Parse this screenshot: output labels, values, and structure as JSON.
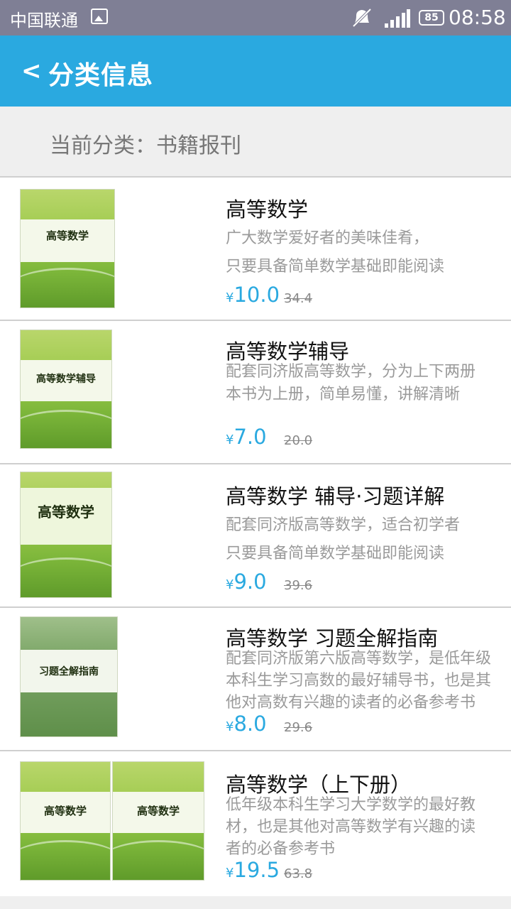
{
  "status_bar": {
    "carrier": "中国联通",
    "battery": "85",
    "time": "08:58"
  },
  "header": {
    "back_symbol": "<",
    "title": "分类信息"
  },
  "category": {
    "text": "当前分类：书籍报刊"
  },
  "items": [
    {
      "title": "高等数学",
      "desc_lines": [
        "广大数学爱好者的美味佳肴，",
        "只要具备简单数学基础即能阅读"
      ],
      "currency": "¥",
      "price": "10.0",
      "old_price": "34.4",
      "cover_text": "高等数学"
    },
    {
      "title": "高等数学辅导",
      "desc_lines": [
        "配套同济版高等数学，分为上下两册",
        "本书为上册，简单易懂，讲解清晰"
      ],
      "currency": "¥",
      "price": "7.0",
      "old_price": "20.0",
      "cover_text": "高等数学辅导"
    },
    {
      "title": "高等数学 辅导·习题详解",
      "desc_lines": [
        "配套同济版高等数学，适合初学者",
        "只要具备简单数学基础即能阅读"
      ],
      "currency": "¥",
      "price": "9.0",
      "old_price": "39.6",
      "cover_text": "高等数学"
    },
    {
      "title": "高等数学 习题全解指南",
      "desc_lines": [
        "配套同济版第六版高等数学，是低年级",
        "本科生学习高数的最好辅导书，也是其",
        "他对高数有兴趣的读者的必备参考书"
      ],
      "currency": "¥",
      "price": "8.0",
      "old_price": "29.6",
      "cover_text": "习题全解指南"
    },
    {
      "title": "高等数学（上下册）",
      "desc_lines": [
        "低年级本科生学习大学数学的最好教",
        "材，也是其他对高等数学有兴趣的读",
        "者的必备参考书"
      ],
      "currency": "¥",
      "price": "19.5",
      "old_price": "63.8",
      "cover_text": "高等数学"
    }
  ]
}
